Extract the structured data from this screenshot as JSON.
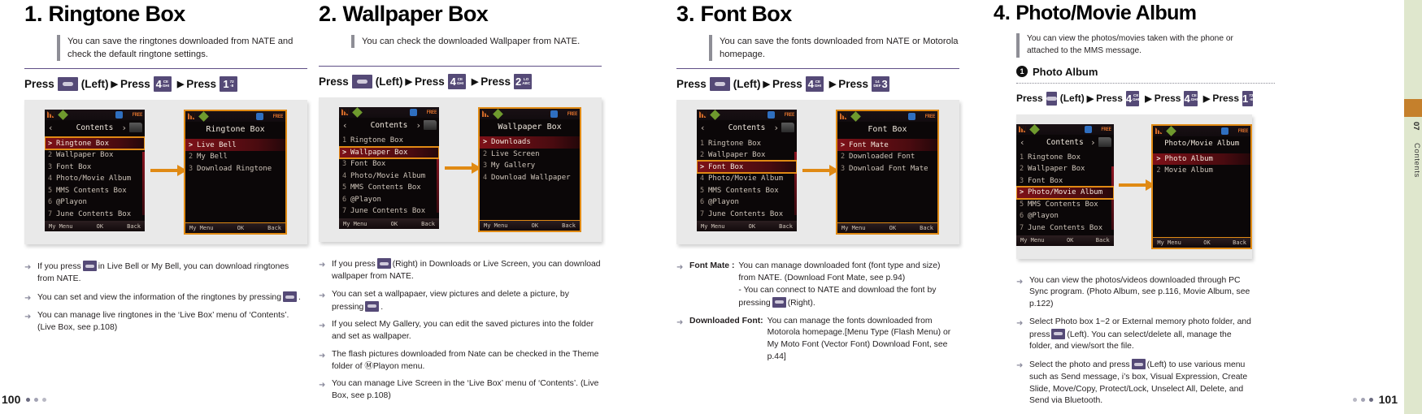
{
  "edge_tab": {
    "label": "Contents",
    "number": "07"
  },
  "footer": {
    "left_page": "100",
    "right_page": "101"
  },
  "common": {
    "press_word": "Press",
    "left_label": "(Left)",
    "right_label": "(Right)",
    "triangle": "▶",
    "softkeys": {
      "left": "My Menu",
      "center": "OK",
      "right": "Back"
    },
    "contents_title": "Contents",
    "contents_items": [
      "Ringtone Box",
      "Wallpaper Box",
      "Font Box",
      "Photo/Movie Album",
      "MMS Contents Box",
      "@Playon",
      "June Contents Box"
    ],
    "bullet_arrow": "➜"
  },
  "sections": [
    {
      "number": "1.",
      "title": "Ringtone Box",
      "lede": "You can save the ringtones downloaded from NATE and check the default ringtone settings.",
      "keys": [
        {
          "type": "soft",
          "label": "soft-key"
        },
        {
          "type": "num",
          "digit": "4",
          "sub": "CE\nGHI"
        },
        {
          "type": "num",
          "digit": "1",
          "sub": "72\n-8"
        }
      ],
      "left_screen": {
        "selected_index": 1
      },
      "right_screen": {
        "title": "Ringtone Box",
        "items": [
          "Live Bell",
          "My Bell",
          "Download Ringtone"
        ],
        "selected_index": 1
      },
      "notes": [
        {
          "pre": "If you press",
          "key": true,
          "post": "in Live Bell or My Bell, you can download ringtones from NATE."
        },
        {
          "pre": "You can set and view the information of the ringtones by pressing",
          "key": true,
          "post": "."
        },
        {
          "pre": "You can manage live ringtones in the ‘Live Box’ menu of ‘Contents’. (Live Box, see p.108)",
          "key": false,
          "post": ""
        }
      ]
    },
    {
      "number": "2.",
      "title": "Wallpaper Box",
      "lede": "You can check the downloaded Wallpaper from NATE.",
      "keys": [
        {
          "type": "soft",
          "label": "soft-key"
        },
        {
          "type": "num",
          "digit": "4",
          "sub": "CE\nGHI"
        },
        {
          "type": "num",
          "digit": "2",
          "sub": "LO\nABC"
        }
      ],
      "left_screen": {
        "selected_index": 2
      },
      "right_screen": {
        "title": "Wallpaper Box",
        "items": [
          "Downloads",
          "Live Screen",
          "My Gallery",
          "Download Wallpaper"
        ],
        "selected_index": 1
      },
      "notes": [
        {
          "pre": "If you press",
          "key": true,
          "post": "(Right) in Downloads or Live Screen, you can download wallpaper from NATE."
        },
        {
          "pre": "You can set a wallpapaer, view pictures and delete a picture, by pressing",
          "key": true,
          "post": "."
        },
        {
          "pre": "If you select My Gallery, you can edit the saved pictures into the folder and set as wallpaper.",
          "key": false,
          "post": ""
        },
        {
          "pre": "The flash pictures downloaded from Nate can be checked in the Theme folder of ⓂPlayon menu.",
          "key": false,
          "post": ""
        },
        {
          "pre": "You can manage Live Screen in the ‘Live Box’ menu of ‘Contents’. (Live Box, see p.108)",
          "key": false,
          "post": ""
        }
      ]
    },
    {
      "number": "3.",
      "title": "Font Box",
      "lede": "You can save the fonts downloaded from NATE or Motorola homepage.",
      "keys": [
        {
          "type": "soft",
          "label": "soft-key"
        },
        {
          "type": "num",
          "digit": "4",
          "sub": "CE\nGHI"
        },
        {
          "type": "num-rev",
          "digit": "3",
          "sub": "14\nDEF"
        }
      ],
      "left_screen": {
        "selected_index": 3
      },
      "right_screen": {
        "title": "Font Box",
        "items": [
          "Font Mate",
          "Downloaded Font",
          "Download Font Mate"
        ],
        "selected_index": 1
      },
      "notes_labeled": [
        {
          "label": "Font Mate :",
          "lines": [
            "You can manage downloaded font (font type and size) from NATE. (Download Font Mate, see p.94)",
            "- You can connect to NATE and download the font by pressing"
          ],
          "key_after": true,
          "tail": "(Right)."
        },
        {
          "label": "Downloaded Font:",
          "lines": [
            "You can manage the fonts downloaded from Motorola homepage.[Menu Type (Flash Menu) or My Moto Font (Vector Font) Download Font, see p.44]"
          ],
          "key_after": false,
          "tail": ""
        }
      ]
    },
    {
      "number": "4.",
      "title": "Photo/Movie Album",
      "lede": "You can view the photos/movies taken with the phone or attached to the MMS message.",
      "subhead": {
        "num": "❶",
        "text": "Photo Album"
      },
      "keys": [
        {
          "type": "soft",
          "label": "soft-key"
        },
        {
          "type": "num",
          "digit": "4",
          "sub": "CE\nGHI"
        },
        {
          "type": "num",
          "digit": "4",
          "sub": "CE\nGHI"
        },
        {
          "type": "num",
          "digit": "1",
          "sub": "72\n-8"
        }
      ],
      "left_screen": {
        "selected_index": 4
      },
      "right_screen": {
        "title": "Photo/Movie Album",
        "items": [
          "Photo Album",
          "Movie Album"
        ],
        "selected_index": 1
      },
      "notes": [
        {
          "pre": "You can view the photos/videos downloaded through PC Sync program. (Photo Album, see p.116, Movie Album, see p.122)",
          "key": false,
          "post": ""
        },
        {
          "pre": "Select Photo box 1~2 or External memory photo folder, and press",
          "key": true,
          "post": "(Left). You can select/delete all, manage the folder, and view/sort the file."
        },
        {
          "pre": "Select the photo and press",
          "key": true,
          "post": "(Left) to use various menu such as Send message, i’s box, Visual Expression, Create Slide, Move/Copy, Protect/Lock, Unselect All, Delete, and Send via Bluetooth."
        }
      ]
    }
  ]
}
